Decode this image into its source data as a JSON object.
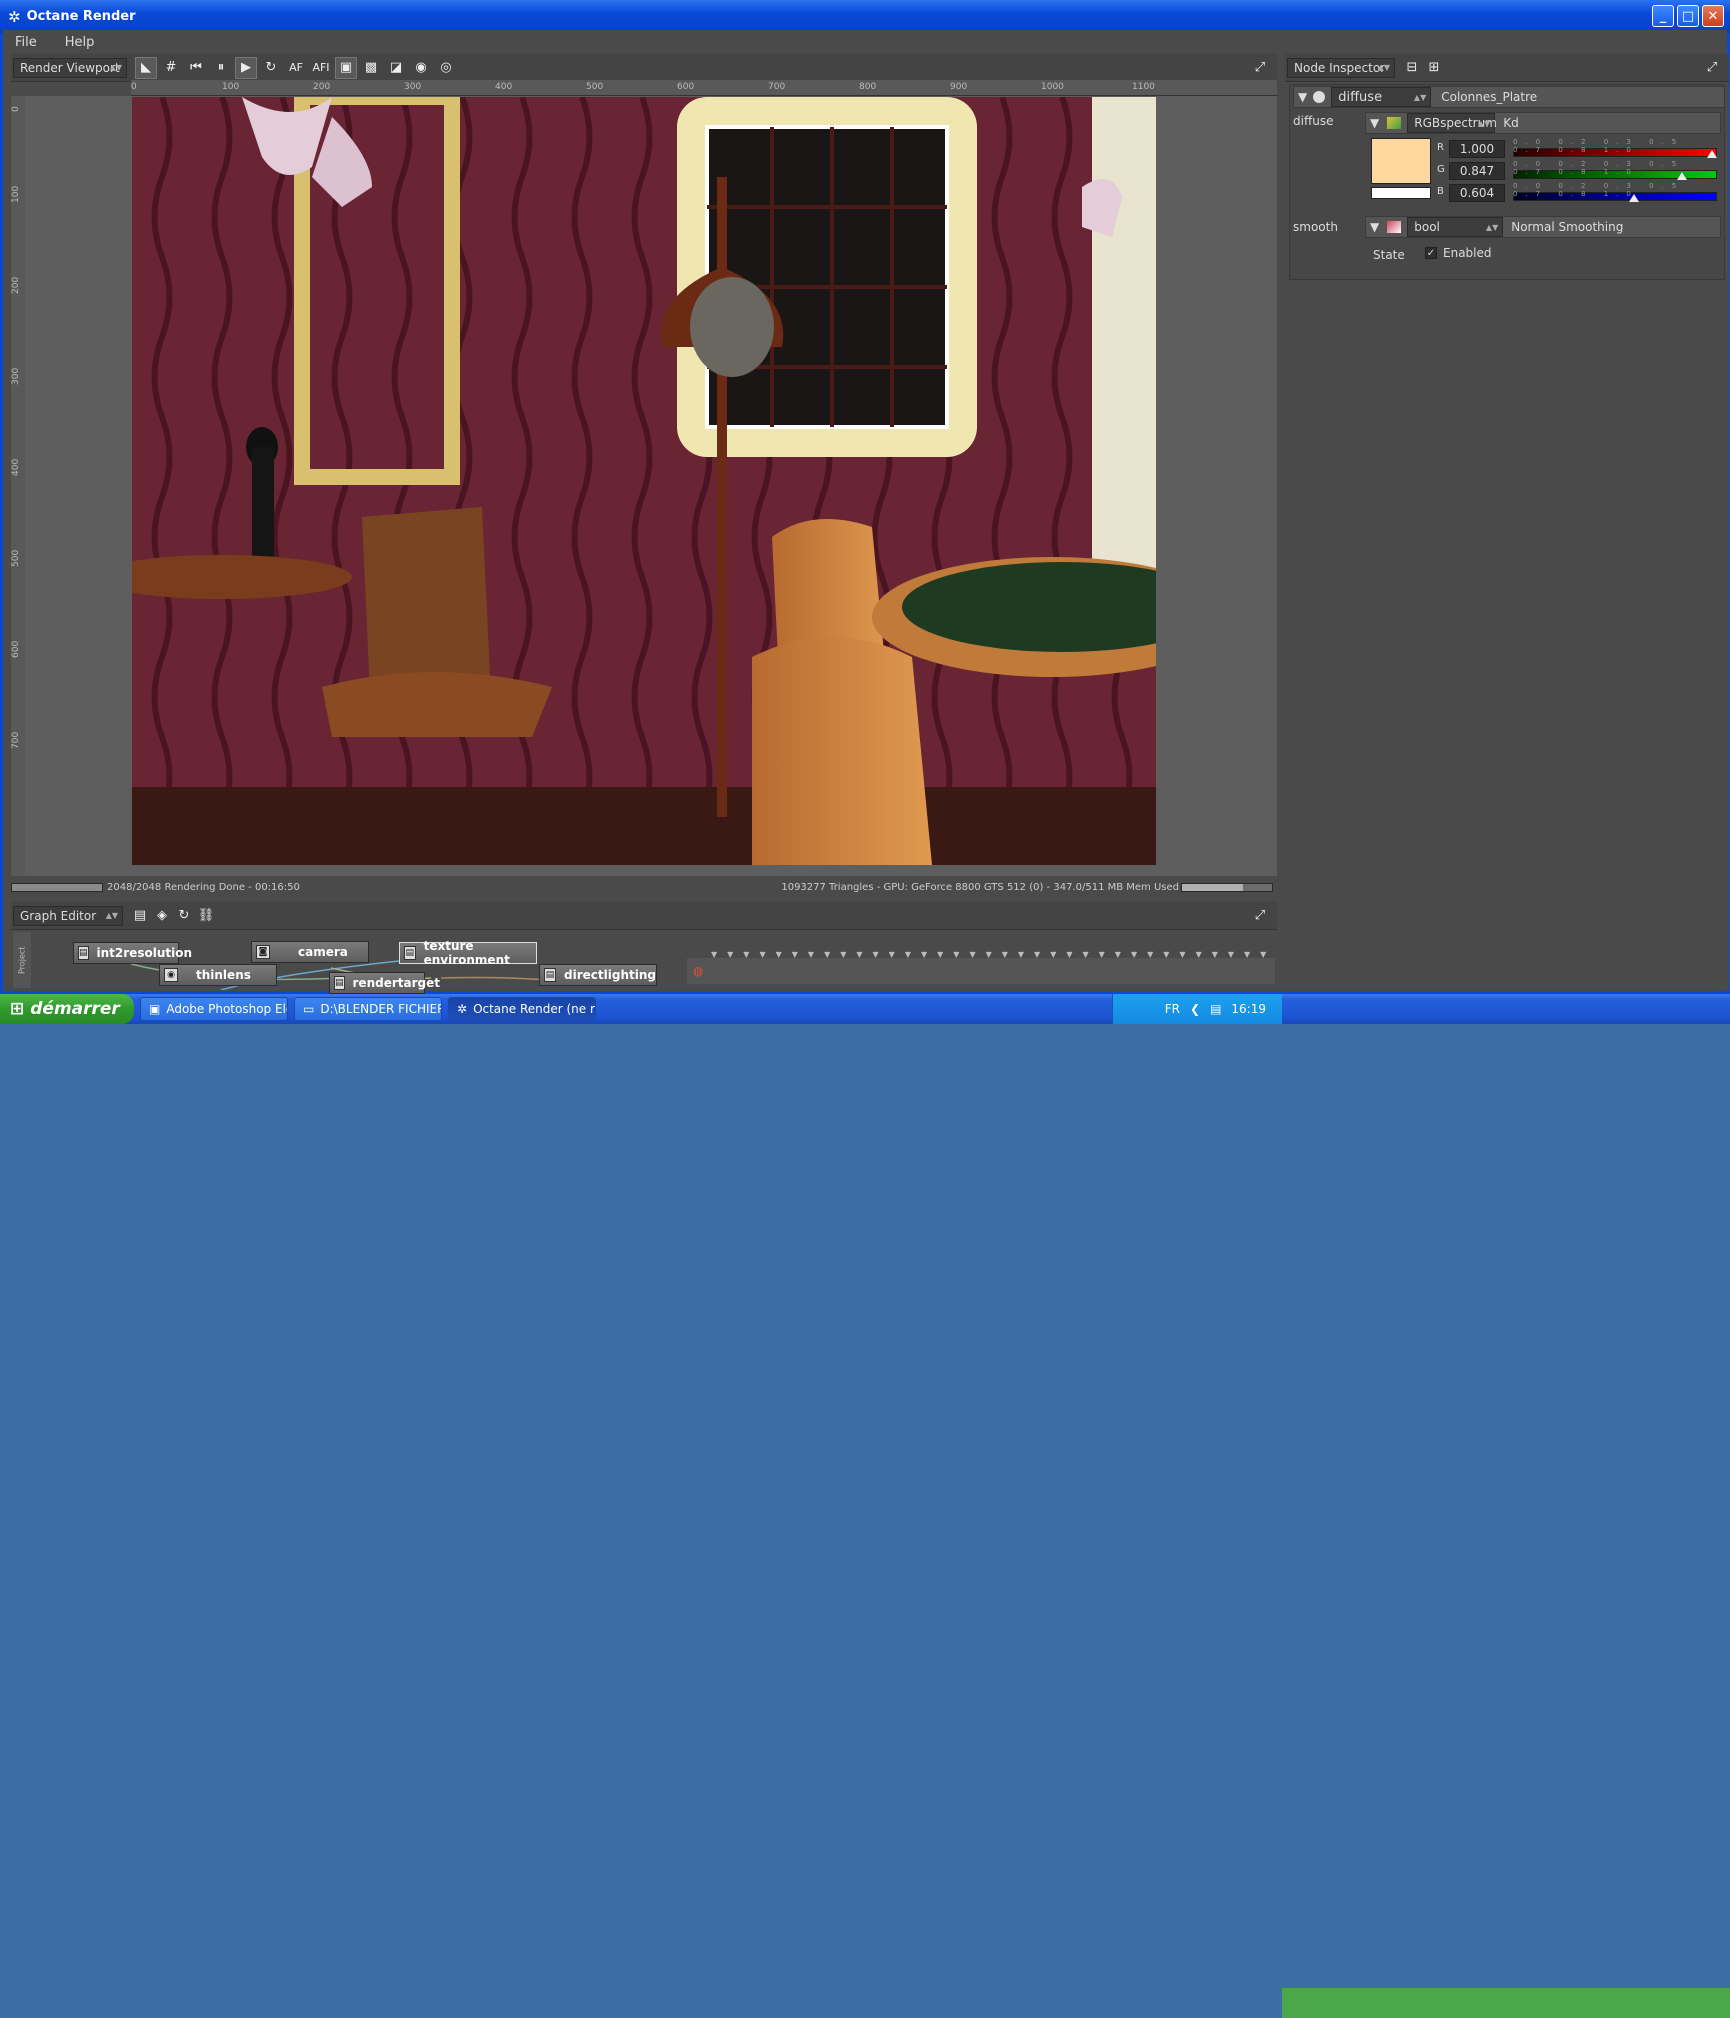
{
  "window": {
    "title": "Octane Render",
    "icon": "octane-logo-icon"
  },
  "menu": [
    "File",
    "Help"
  ],
  "viewport": {
    "panel_label": "Render Viewport",
    "toolbar_icons": [
      "select-arrow-icon",
      "grid-icon",
      "skip-back-icon",
      "pause-icon",
      "play-icon",
      "refresh-icon",
      "af-text",
      "afi-text",
      "frame-icon",
      "checker-icon",
      "region-icon",
      "lock-camera-icon",
      "pick-icon"
    ],
    "af_label": "AF",
    "afi_label": "AFI",
    "ruler_top": [
      "0",
      "100",
      "200",
      "300",
      "400",
      "500",
      "600",
      "700",
      "800",
      "900",
      "1000",
      "1100"
    ],
    "ruler_left": [
      "0",
      "100",
      "200",
      "300",
      "400",
      "500",
      "600",
      "700"
    ],
    "status_left": "2048/2048 Rendering Done - 00:16:50",
    "status_right": "1093277 Triangles - GPU: GeForce 8800 GTS 512 (0) - 347.0/511 MB Mem Used",
    "progress": 1.0,
    "mem_progress": 0.68
  },
  "inspector": {
    "panel_label": "Node Inspector",
    "root": {
      "type": "diffuse",
      "name": "Colonnes_Platre"
    },
    "diffuse_label": "diffuse",
    "diffuse_node": {
      "type": "RGBspectrum",
      "name": "Kd"
    },
    "color": {
      "swatch": "#ffd8a0",
      "r_label": "R",
      "g_label": "G",
      "b_label": "B",
      "r": "1.000",
      "g": "0.847",
      "b": "0.604",
      "r_frac": 1.0,
      "g_frac": 0.847,
      "b_frac": 0.604
    },
    "scale_ticks": [
      "0.0",
      "0.2",
      "0.3",
      "0.5",
      "0.7",
      "0.8",
      "1.0"
    ],
    "smooth_label": "smooth",
    "smooth_node": {
      "type": "bool",
      "name": "Normal Smoothing"
    },
    "state_label": "State",
    "state_value": "Enabled"
  },
  "graph": {
    "panel_label": "Graph Editor",
    "side_label": "Project",
    "nodes": [
      {
        "label": "int2resolution"
      },
      {
        "label": "camera"
      },
      {
        "label": "texture environment"
      },
      {
        "label": "thinlens"
      },
      {
        "label": "rendertarget"
      },
      {
        "label": "directlighting"
      }
    ]
  },
  "taskbar": {
    "start": "démarrer",
    "tasks": [
      {
        "label": "Adobe Photoshop Ele...",
        "active": false
      },
      {
        "label": "D:\\BLENDER FICHIER...",
        "active": false
      },
      {
        "label": "Octane Render (ne r...",
        "active": true
      }
    ],
    "lang": "FR",
    "clock": "16:19"
  }
}
